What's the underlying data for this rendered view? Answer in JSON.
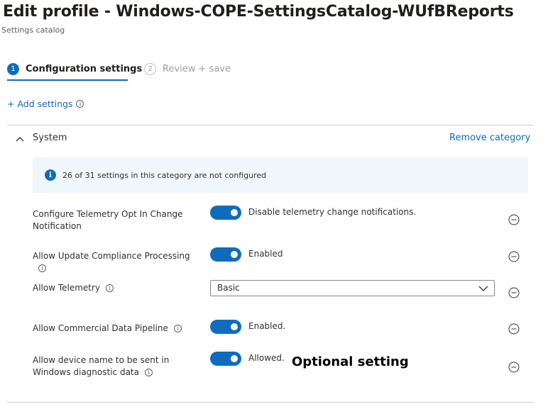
{
  "header": {
    "title": "Edit profile - Windows-COPE-SettingsCatalog-WUfBReports",
    "more_label": "···",
    "subtitle": "Settings catalog"
  },
  "wizard": {
    "steps": [
      {
        "number": "1",
        "label": "Configuration settings",
        "active": true
      },
      {
        "number": "2",
        "label": "Review + save",
        "active": false
      }
    ]
  },
  "add_settings_label": "+ Add settings",
  "category": {
    "name": "System",
    "remove_label": "Remove category",
    "banner_text": "26 of 31 settings in this category are not configured"
  },
  "settings": [
    {
      "label": "Configure Telemetry Opt In Change Notification",
      "control": "toggle",
      "value": "Disable telemetry change notifications.",
      "has_info": false
    },
    {
      "label": "Allow Update Compliance Processing",
      "control": "toggle",
      "value": "Enabled",
      "has_info": true
    },
    {
      "label": "Allow Telemetry",
      "control": "dropdown",
      "value": "Basic",
      "has_info": true
    },
    {
      "label": "Allow Commercial Data Pipeline",
      "control": "toggle",
      "value": "Enabled.",
      "has_info": true
    },
    {
      "label": "Allow device name to be sent in Windows diagnostic data",
      "control": "toggle",
      "value": "Allowed.",
      "has_info": true
    }
  ],
  "annotation_text": "Optional setting",
  "colors": {
    "accent": "#0f6cbd",
    "banner_bg": "#eff6fc",
    "text": "#323130"
  },
  "icons": {
    "info": "info-icon",
    "collapse": "chevron-up-icon",
    "remove": "minus-circle-icon",
    "dropdown": "chevron-down-icon"
  }
}
